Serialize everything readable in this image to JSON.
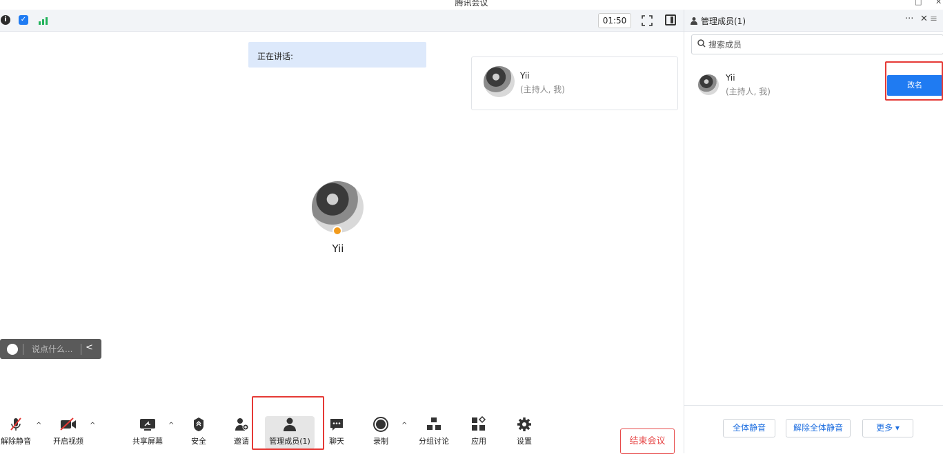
{
  "window": {
    "title": "腾讯会议",
    "restore_glyph": "□",
    "close_glyph": "✕"
  },
  "topbar": {
    "timer": "01:50",
    "icons": [
      "info-icon",
      "shield-icon",
      "signal-icon"
    ]
  },
  "meeting": {
    "speaking_label": "正在讲话:",
    "tile": {
      "name": "Yii",
      "role": "(主持人, 我)"
    },
    "center_name": "Yii",
    "chat_placeholder": "说点什么..."
  },
  "toolbar": {
    "items": [
      {
        "label": "解除静音",
        "icon": "mic-off-icon"
      },
      {
        "label": "开启视频",
        "icon": "video-off-icon"
      },
      {
        "label": "共享屏幕",
        "icon": "share-screen-icon"
      },
      {
        "label": "安全",
        "icon": "security-icon"
      },
      {
        "label": "邀请",
        "icon": "invite-icon"
      },
      {
        "label": "管理成员(1)",
        "icon": "members-icon"
      },
      {
        "label": "聊天",
        "icon": "chat-icon"
      },
      {
        "label": "录制",
        "icon": "record-icon"
      },
      {
        "label": "分组讨论",
        "icon": "breakout-icon"
      },
      {
        "label": "应用",
        "icon": "apps-icon"
      },
      {
        "label": "设置",
        "icon": "settings-icon"
      }
    ],
    "end_meeting": "结束会议"
  },
  "panel": {
    "title": "管理成员(1)",
    "more_glyph": "···",
    "close_glyph": "✕",
    "search_placeholder": "搜索成员",
    "member": {
      "name": "Yii",
      "role": "(主持人, 我)",
      "rename_label": "改名"
    },
    "footer": {
      "mute_all": "全体静音",
      "unmute_all": "解除全体静音",
      "more": "更多 ▾"
    }
  },
  "accent_color": "#1f7bf2",
  "highlight_color": "#e53935"
}
